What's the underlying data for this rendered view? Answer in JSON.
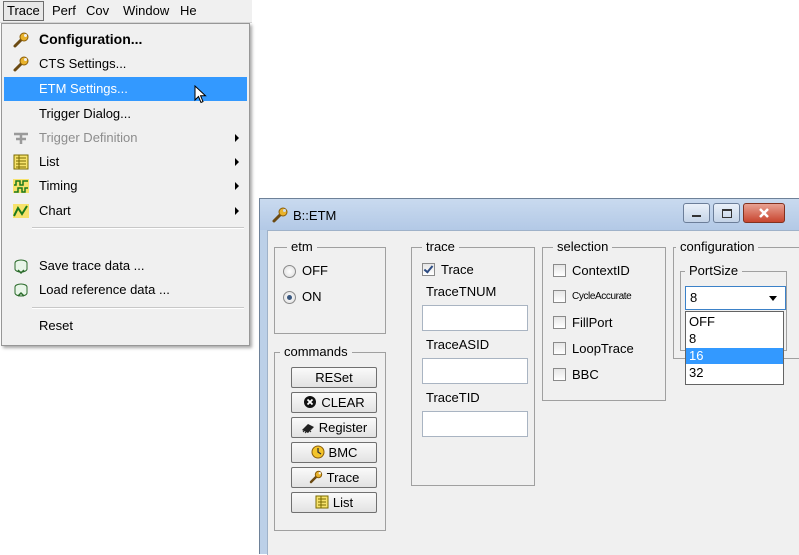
{
  "menubar": {
    "items": [
      "Trace",
      "Perf",
      "Cov",
      "Window",
      "He"
    ]
  },
  "menu": {
    "configuration": "Configuration...",
    "cts_settings": "CTS Settings...",
    "etm_settings": "ETM Settings...",
    "trigger_dialog": "Trigger Dialog...",
    "trigger_definition": "Trigger Definition",
    "list": "List",
    "timing": "Timing",
    "chart": "Chart",
    "save_trace": "Save trace data ...",
    "load_reference": "Load reference data ...",
    "reset": "Reset"
  },
  "window": {
    "title": "B::ETM",
    "etm": {
      "title": "etm",
      "off": "OFF",
      "on": "ON",
      "selected": "ON"
    },
    "commands": {
      "title": "commands",
      "reset": "RESet",
      "clear": "CLEAR",
      "register": "Register",
      "bmc": "BMC",
      "trace": "Trace",
      "list": "List"
    },
    "trace": {
      "title": "trace",
      "trace_checkbox": "Trace",
      "trace_checked": true,
      "tracetnum": "TraceTNUM",
      "traceasid": "TraceASID",
      "tracetid": "TraceTID"
    },
    "selection": {
      "title": "selection",
      "contextid": "ContextID",
      "cycleaccurate": "CycleAccurate",
      "fillport": "FillPort",
      "looptrace": "LoopTrace",
      "bbc": "BBC"
    },
    "configuration": {
      "title": "configuration",
      "portsize_label": "PortSize",
      "portsize_value": "8",
      "options": [
        "OFF",
        "8",
        "16",
        "32"
      ],
      "highlighted_option": "16"
    }
  },
  "colors": {
    "highlight": "#3399ff",
    "menu_bg": "#f0f0f0",
    "window_frame": "#bcd0e8"
  }
}
